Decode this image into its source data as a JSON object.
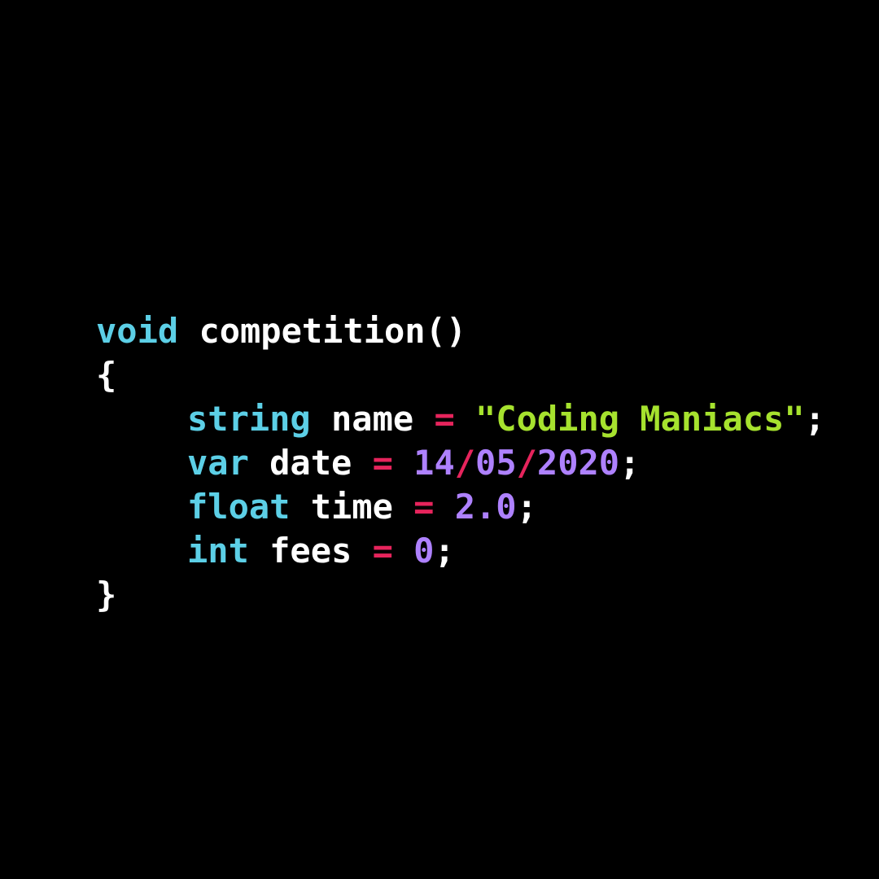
{
  "colors": {
    "background": "#000000",
    "keyword": "#5ccfe6",
    "identifier": "#ffffff",
    "operator": "#e6245c",
    "string": "#a6e22e",
    "number": "#ae81ff",
    "punctuation": "#ffffff"
  },
  "code": {
    "lines": [
      {
        "indent": false,
        "tokens": [
          {
            "text": "void",
            "kind": "keyword"
          },
          {
            "text": " competition()",
            "kind": "identifier"
          }
        ]
      },
      {
        "indent": false,
        "tokens": [
          {
            "text": "{",
            "kind": "punctuation"
          }
        ]
      },
      {
        "indent": true,
        "tokens": [
          {
            "text": "string",
            "kind": "keyword"
          },
          {
            "text": " name ",
            "kind": "identifier"
          },
          {
            "text": "=",
            "kind": "operator"
          },
          {
            "text": " \"Coding Maniacs\"",
            "kind": "string"
          },
          {
            "text": ";",
            "kind": "punctuation"
          }
        ]
      },
      {
        "indent": true,
        "tokens": [
          {
            "text": "var",
            "kind": "keyword"
          },
          {
            "text": " date ",
            "kind": "identifier"
          },
          {
            "text": "=",
            "kind": "operator"
          },
          {
            "text": " 14",
            "kind": "number"
          },
          {
            "text": "/",
            "kind": "operator"
          },
          {
            "text": "05",
            "kind": "number"
          },
          {
            "text": "/",
            "kind": "operator"
          },
          {
            "text": "2020",
            "kind": "number"
          },
          {
            "text": ";",
            "kind": "punctuation"
          }
        ]
      },
      {
        "indent": true,
        "tokens": [
          {
            "text": "float",
            "kind": "keyword"
          },
          {
            "text": " time ",
            "kind": "identifier"
          },
          {
            "text": "=",
            "kind": "operator"
          },
          {
            "text": " 2.0",
            "kind": "number"
          },
          {
            "text": ";",
            "kind": "punctuation"
          }
        ]
      },
      {
        "indent": true,
        "tokens": [
          {
            "text": "int",
            "kind": "keyword"
          },
          {
            "text": " fees ",
            "kind": "identifier"
          },
          {
            "text": "=",
            "kind": "operator"
          },
          {
            "text": " 0",
            "kind": "number"
          },
          {
            "text": ";",
            "kind": "punctuation"
          }
        ]
      },
      {
        "indent": false,
        "tokens": [
          {
            "text": "}",
            "kind": "punctuation"
          }
        ]
      }
    ]
  }
}
